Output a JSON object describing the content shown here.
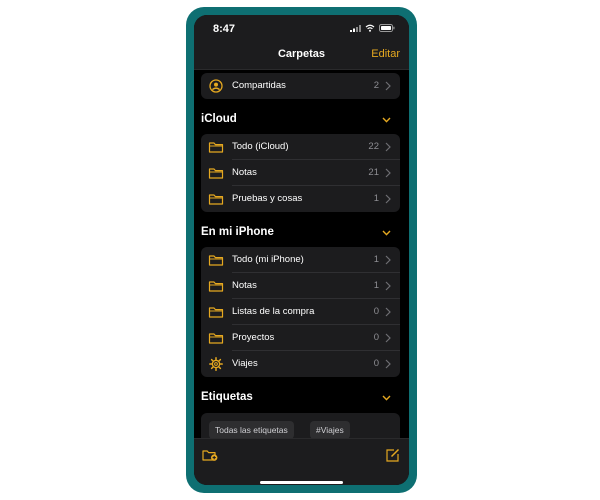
{
  "status_bar": {
    "time": "8:47",
    "signal_icon": "signal-bars-icon",
    "wifi_icon": "wifi-icon",
    "battery_icon": "battery-icon"
  },
  "nav": {
    "title": "Carpetas",
    "edit": "Editar"
  },
  "shared": {
    "label": "Compartidas",
    "count": "2",
    "icon": "person-circle-icon"
  },
  "icloud": {
    "title": "iCloud",
    "folders": [
      {
        "label": "Todo (iCloud)",
        "count": "22",
        "icon": "folder-icon"
      },
      {
        "label": "Notas",
        "count": "21",
        "icon": "folder-icon"
      },
      {
        "label": "Pruebas y cosas",
        "count": "1",
        "icon": "folder-icon"
      }
    ]
  },
  "iphone": {
    "title": "En mi iPhone",
    "folders": [
      {
        "label": "Todo (mi iPhone)",
        "count": "1",
        "icon": "folder-icon"
      },
      {
        "label": "Notas",
        "count": "1",
        "icon": "folder-icon"
      },
      {
        "label": "Listas de la compra",
        "count": "0",
        "icon": "folder-icon"
      },
      {
        "label": "Proyectos",
        "count": "0",
        "icon": "folder-icon"
      },
      {
        "label": "Viajes",
        "count": "0",
        "icon": "gear-icon"
      }
    ]
  },
  "tags": {
    "title": "Etiquetas",
    "items": [
      "Todas las etiquetas",
      "#Viajes"
    ]
  },
  "toolbar": {
    "new_folder_icon": "new-folder-icon",
    "compose_icon": "compose-icon"
  },
  "colors": {
    "accent": "#e5a820",
    "background": "#000000",
    "group_bg": "#1c1c1e",
    "frame": "#0e6f72"
  }
}
